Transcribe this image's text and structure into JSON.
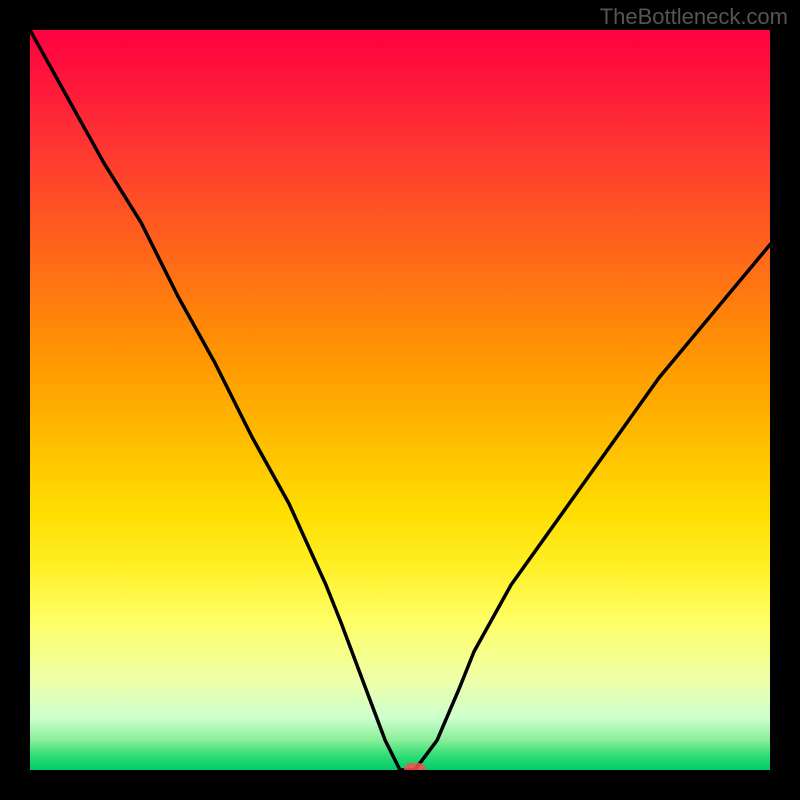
{
  "watermark": "TheBottleneck.com",
  "chart_data": {
    "type": "line",
    "title": "",
    "xlabel": "",
    "ylabel": "",
    "xlim": [
      0,
      100
    ],
    "ylim": [
      0,
      100
    ],
    "x": [
      0,
      5,
      10,
      15,
      20,
      25,
      30,
      35,
      40,
      42,
      45,
      48,
      50,
      52,
      55,
      58,
      60,
      65,
      70,
      75,
      80,
      85,
      90,
      95,
      100
    ],
    "values": [
      100,
      91,
      82,
      74,
      64,
      55,
      45,
      36,
      25,
      20,
      12,
      4,
      0,
      0,
      4,
      11,
      16,
      25,
      32,
      39,
      46,
      53,
      59,
      65,
      71
    ],
    "marker": {
      "x": 52,
      "y": 0
    },
    "gradient_stops": [
      {
        "pos": 0,
        "color": "#ff0040",
        "meaning": "high-bottleneck"
      },
      {
        "pos": 50,
        "color": "#ffcc00",
        "meaning": "moderate"
      },
      {
        "pos": 100,
        "color": "#00cc66",
        "meaning": "optimal"
      }
    ]
  }
}
